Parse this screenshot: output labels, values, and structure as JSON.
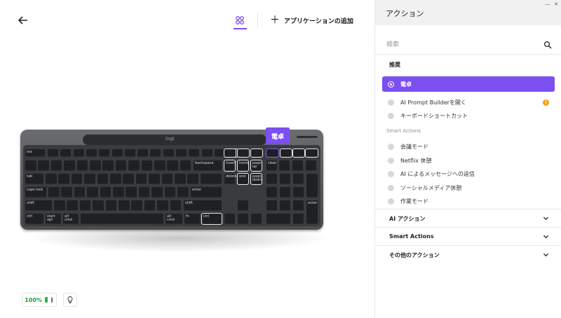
{
  "header": {
    "add_app_label": "アプリケーションの追加",
    "icons": {
      "back": "arrow-left-icon",
      "grid": "grid-icon",
      "plus": "plus-icon"
    }
  },
  "keyboard": {
    "brand": "logi",
    "tooltip": "電卓",
    "keys": {
      "esc": "esc",
      "insert": "insert",
      "home": "home",
      "pgup": "page\nup",
      "delete": "delete",
      "end": "end",
      "pgdn": "page\ndown",
      "tab": "tab",
      "caps": "caps lock",
      "shift_l": "shift",
      "shift_r": "shift",
      "enter": "enter",
      "backspace": "backspace",
      "ctrl_l": "ctrl",
      "start": "start\nopt",
      "alt_l": "alt\ncmd",
      "alt_r": "alt\ncmd",
      "fn": "fn",
      "ctrl_r": "ctrl",
      "clear": "clear",
      "num_enter": "enter",
      "home_num": "home",
      "pgup_num": "pg up",
      "end_num": "end",
      "pgdn_num": "pg dn",
      "ins": "ins",
      "del": "del"
    }
  },
  "status": {
    "battery": "100%",
    "icons": {
      "battery": "battery-icon",
      "bluetooth": "bluetooth-icon",
      "lightbulb": "lightbulb-icon"
    }
  },
  "panel": {
    "title": "アクション",
    "search_placeholder": "検索",
    "recommended_title": "推奨",
    "recommended": [
      {
        "label": "電卓",
        "active": true
      },
      {
        "label": "AI Prompt Builderを開く",
        "warning": "!"
      },
      {
        "label": "キーボードショートカット"
      }
    ],
    "smart_title": "Smart Actions",
    "smart": [
      {
        "label": "会議モード"
      },
      {
        "label": "Netflix 休憩"
      },
      {
        "label": "AI によるメッセージへの返信"
      },
      {
        "label": "ソーシャルメディア休憩"
      },
      {
        "label": "作業モード"
      }
    ],
    "sections": [
      {
        "label": "AI アクション"
      },
      {
        "label": "Smart Actions"
      },
      {
        "label": "その他のアクション"
      }
    ],
    "icons": {
      "search": "search-icon",
      "chevron": "chevron-down-icon"
    }
  },
  "colors": {
    "accent": "#7b4ff0",
    "battery": "#2bb24c",
    "warning": "#f0a11a"
  }
}
